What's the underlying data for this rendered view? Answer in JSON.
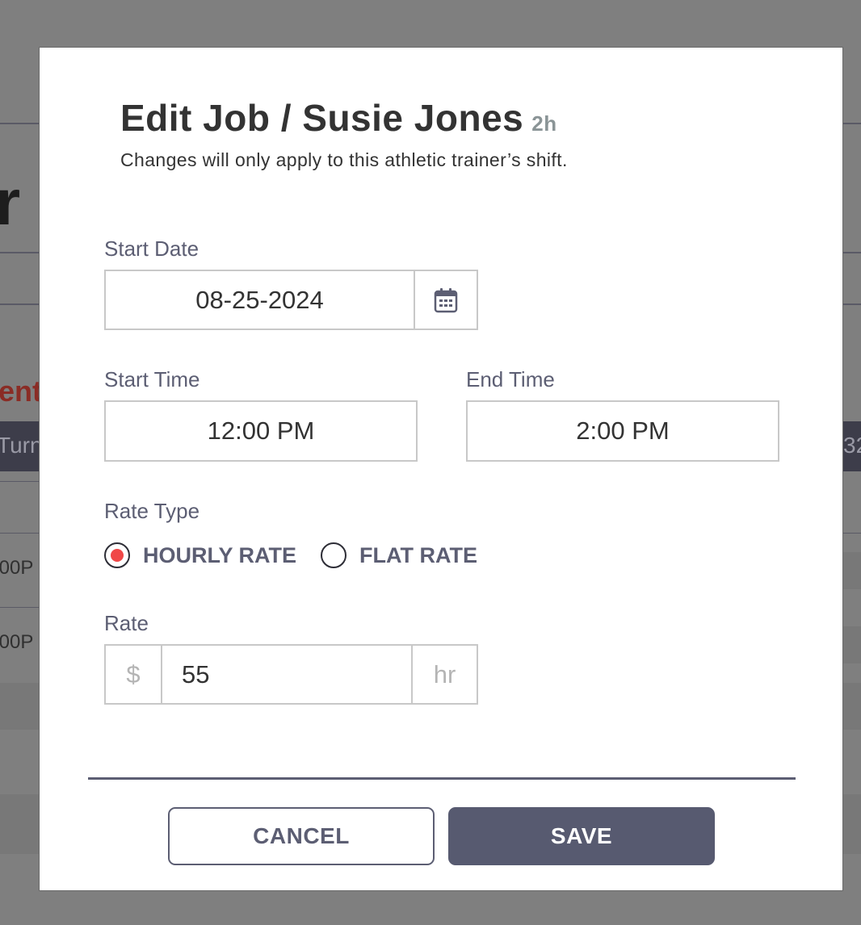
{
  "background": {
    "fragment_1": "r",
    "fragment_2": "ent",
    "fragment_3": "Turn",
    "fragment_4": "32",
    "fragment_5": ":00P",
    "fragment_6": ":00P"
  },
  "modal": {
    "title": "Edit Job / Susie Jones",
    "duration": "2h",
    "subtitle": "Changes will only apply to this athletic trainer’s shift."
  },
  "form": {
    "start_date": {
      "label": "Start Date",
      "value": "08-25-2024",
      "icon": "calendar-icon"
    },
    "start_time": {
      "label": "Start Time",
      "value": "12:00 PM"
    },
    "end_time": {
      "label": "End Time",
      "value": "2:00 PM"
    },
    "rate_type": {
      "label": "Rate Type",
      "options": [
        {
          "label": "HOURLY RATE",
          "selected": true
        },
        {
          "label": "FLAT RATE",
          "selected": false
        }
      ]
    },
    "rate": {
      "label": "Rate",
      "prefix": "$",
      "value": "55",
      "suffix": "hr"
    }
  },
  "actions": {
    "cancel_label": "CANCEL",
    "save_label": "SAVE"
  },
  "colors": {
    "overlay": "#7f7f7f",
    "accent_radio": "#f04848",
    "primary_button": "#575a70",
    "label_text": "#5c5e73"
  }
}
